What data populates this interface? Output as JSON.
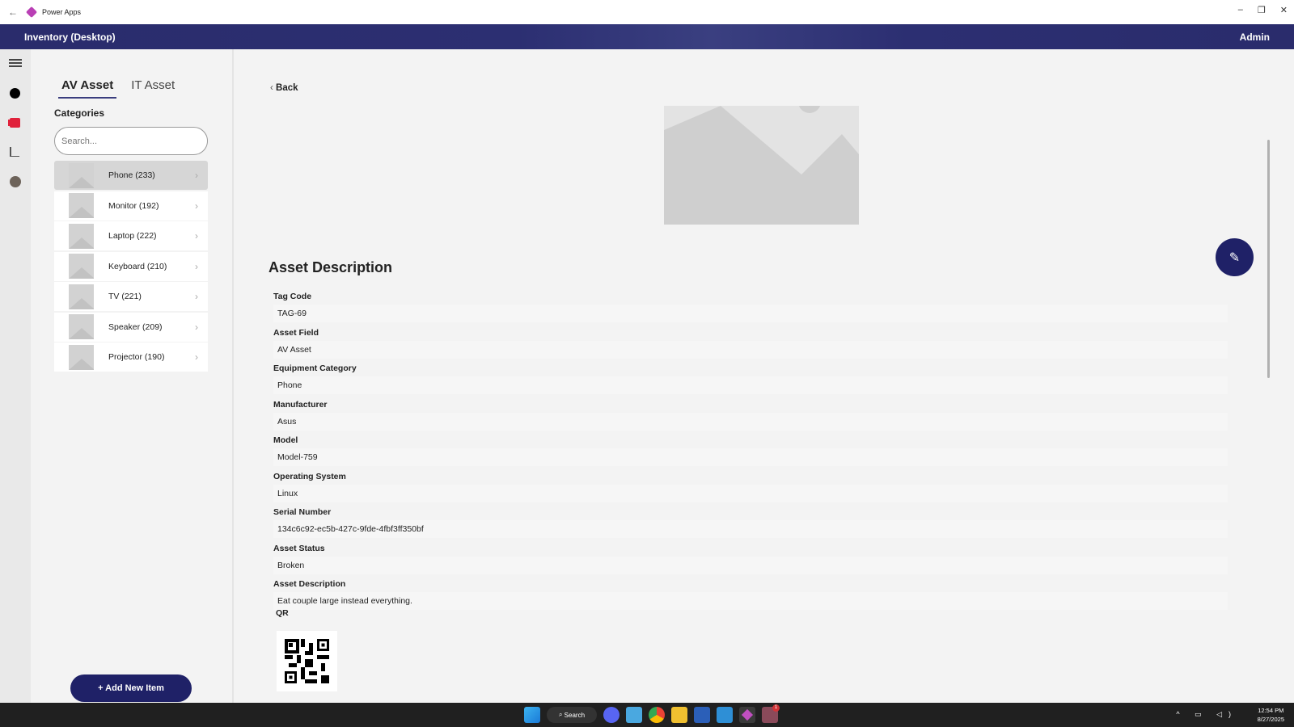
{
  "window": {
    "title": "Power Apps",
    "minimize": "–",
    "restore": "❐",
    "close": "✕"
  },
  "header": {
    "app_title": "Inventory (Desktop)",
    "user": "Admin"
  },
  "tabs": [
    {
      "label": "AV Asset"
    },
    {
      "label": "IT Asset"
    }
  ],
  "categories": {
    "heading": "Categories",
    "search_placeholder": "Search...",
    "items": [
      {
        "label": "Phone (233)"
      },
      {
        "label": "Monitor (192)"
      },
      {
        "label": "Laptop (222)"
      },
      {
        "label": "Keyboard (210)"
      },
      {
        "label": "TV (221)"
      },
      {
        "label": "Speaker (209)"
      },
      {
        "label": "Projector (190)"
      }
    ]
  },
  "add_button": "+ Add New Item",
  "main": {
    "back": "Back",
    "section_title": "Asset Description",
    "fields": [
      {
        "label": "Tag Code",
        "value": "TAG-69"
      },
      {
        "label": "Asset Field",
        "value": "AV Asset"
      },
      {
        "label": "Equipment Category",
        "value": "Phone"
      },
      {
        "label": "Manufacturer",
        "value": "Asus"
      },
      {
        "label": "Model",
        "value": "Model-759"
      },
      {
        "label": "Operating System",
        "value": "Linux"
      },
      {
        "label": "Serial Number",
        "value": "134c6c92-ec5b-427c-9fde-4fbf3ff350bf"
      },
      {
        "label": "Asset Status",
        "value": "Broken"
      },
      {
        "label": "Asset Description",
        "value": "Eat couple large instead everything."
      }
    ],
    "qr_label": "QR"
  },
  "taskbar": {
    "search": "Search",
    "time": "12:54 PM",
    "date": "8/27/2025",
    "teams_badge": "1"
  }
}
